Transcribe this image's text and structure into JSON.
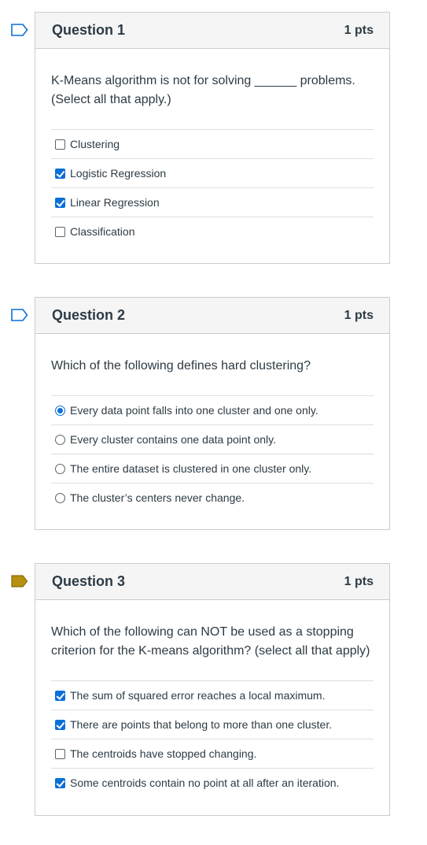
{
  "questions": [
    {
      "title": "Question 1",
      "points": "1 pts",
      "flagged": false,
      "text": "K-Means algorithm is not for solving ______ problems.\n(Select all that apply.)",
      "input_type": "checkbox",
      "answers": [
        {
          "label": "Clustering",
          "selected": false
        },
        {
          "label": "Logistic Regression",
          "selected": true
        },
        {
          "label": "Linear Regression",
          "selected": true
        },
        {
          "label": "Classification",
          "selected": false
        }
      ]
    },
    {
      "title": "Question 2",
      "points": "1 pts",
      "flagged": false,
      "text": "Which of the following defines hard clustering?",
      "input_type": "radio",
      "answers": [
        {
          "label": "Every data point falls into one cluster and one only.",
          "selected": true
        },
        {
          "label": "Every cluster contains one data point only.",
          "selected": false
        },
        {
          "label": "The entire dataset is clustered in one cluster only.",
          "selected": false
        },
        {
          "label": "The cluster’s centers never change.",
          "selected": false
        }
      ]
    },
    {
      "title": "Question 3",
      "points": "1 pts",
      "flagged": true,
      "text": "Which of the following can NOT be used as a stopping\ncriterion for the K-means algorithm? (select all that apply)",
      "input_type": "checkbox",
      "answers": [
        {
          "label": "The sum of squared error reaches a local maximum.",
          "selected": true
        },
        {
          "label": "There are points that belong to more than one cluster.",
          "selected": true
        },
        {
          "label": "The centroids have stopped changing.",
          "selected": false
        },
        {
          "label": "Some centroids contain no point at all after an iteration.",
          "selected": true
        }
      ]
    }
  ],
  "colors": {
    "accent": "#0a6fd8",
    "flag_outline": "#0a6fd8",
    "flag_filled": "#b8900f"
  },
  "icons": {
    "flag": "bookmark-flag-icon",
    "checkbox": "checkbox-icon",
    "radio": "radio-icon"
  }
}
